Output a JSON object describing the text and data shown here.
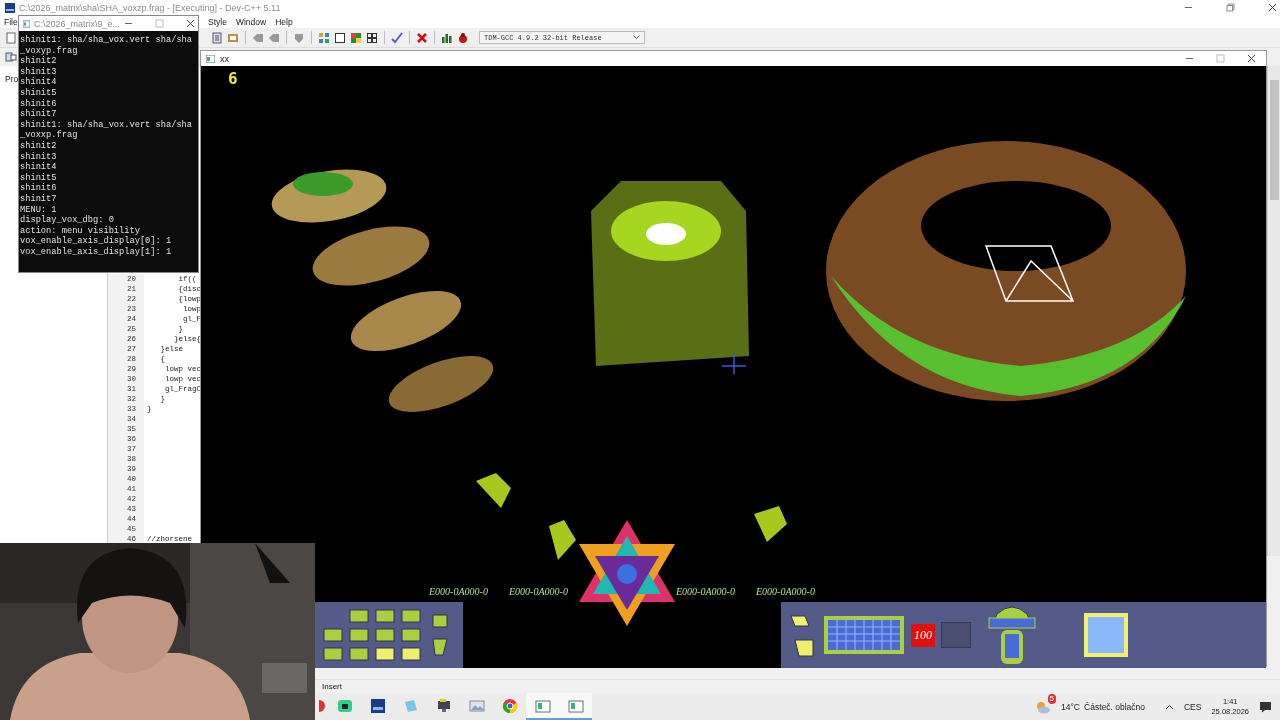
{
  "main_window": {
    "title": "C:\\2026_matrix\\sha\\SHA_voxzp.frag - [Executing] - Dev-C++ 5.11",
    "menu": [
      "File",
      "Style",
      "Window",
      "Help"
    ],
    "compiler": "TDM-GCC 4.9.2 32-bit Release",
    "project_tab": "Pro",
    "editor_lines": [
      {
        "number": "20",
        "code": "       if(("
      },
      {
        "number": "21",
        "code": "       {disc"
      },
      {
        "number": "22",
        "code": "       {lowp"
      },
      {
        "number": "23",
        "code": "        lowp"
      },
      {
        "number": "24",
        "code": "        gl_F"
      },
      {
        "number": "25",
        "code": "       }"
      },
      {
        "number": "26",
        "code": "      }else{"
      },
      {
        "number": "27",
        "code": "   }else"
      },
      {
        "number": "28",
        "code": "   {"
      },
      {
        "number": "29",
        "code": "    lowp vec"
      },
      {
        "number": "30",
        "code": "    lowp vec"
      },
      {
        "number": "31",
        "code": "    gl_FragC"
      },
      {
        "number": "32",
        "code": "   }"
      },
      {
        "number": "33",
        "code": "}"
      },
      {
        "number": "34"
      },
      {
        "number": "35"
      },
      {
        "number": "36"
      },
      {
        "number": "37"
      },
      {
        "number": "38"
      },
      {
        "number": "39"
      },
      {
        "number": "40"
      },
      {
        "number": "41"
      },
      {
        "number": "42"
      },
      {
        "number": "43"
      },
      {
        "number": "44"
      },
      {
        "number": "45"
      },
      {
        "number": "46",
        "code": "//zhorsene"
      }
    ],
    "status": "Insert"
  },
  "console": {
    "title": "C:\\2026_matrix\\9_e...",
    "lines": [
      "shinit1: sha/sha_vox.vert sha/sha",
      "_voxyp.frag",
      "shinit2",
      "shinit3",
      "shinit4",
      "shinit5",
      "shinit6",
      "shinit7",
      "shinit1: sha/sha_vox.vert sha/sha",
      "_voxxp.frag",
      "shinit2",
      "shinit3",
      "shinit4",
      "shinit5",
      "shinit6",
      "shinit7",
      "MENU: 1",
      "display_vox_dbg: 0",
      "action: menu visibility",
      "vox_enable_axis_display[0]: 1",
      "vox_enable_axis_display[1]: 1"
    ]
  },
  "game_window": {
    "title": "xx",
    "score": "6",
    "hud": {
      "counters": [
        "E000-0A000-0",
        "E000-0A000-0",
        "E000-0A000-0",
        "E000-0A000-0"
      ],
      "health": "100"
    }
  },
  "taskbar": {
    "apps": [
      {
        "kind": "media",
        "open": false
      },
      {
        "kind": "shell",
        "open": false
      },
      {
        "kind": "devcpp",
        "open": false
      },
      {
        "kind": "notes",
        "open": false
      },
      {
        "kind": "console",
        "open": false
      },
      {
        "kind": "photos",
        "open": false
      },
      {
        "kind": "browser",
        "open": false
      },
      {
        "kind": "window",
        "open": true
      },
      {
        "kind": "window",
        "open": true
      }
    ],
    "weather": {
      "badge": "5",
      "temperature": "14°C",
      "condition": "Částeč. oblačno"
    },
    "language": "CES",
    "time": "1:41",
    "date": "25.08.2026"
  }
}
